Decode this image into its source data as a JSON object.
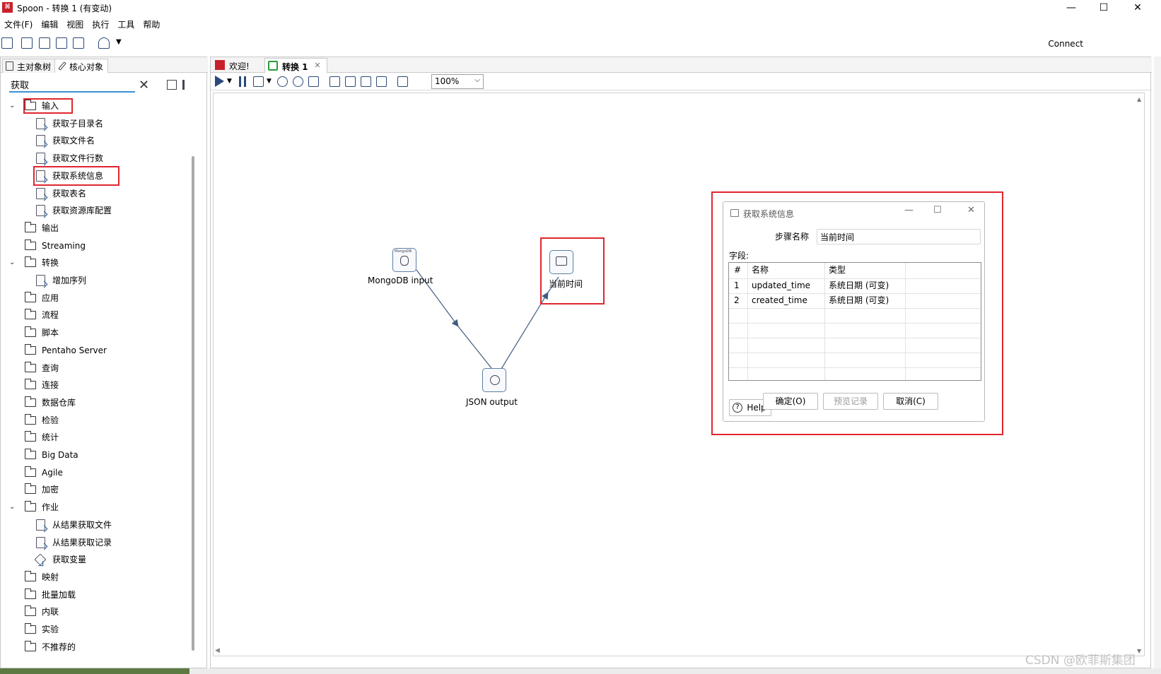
{
  "window": {
    "title": "Spoon - 转换 1 (有变动)",
    "app_icon": "spoon-logo",
    "min_glyph": "—",
    "max_glyph": "☐",
    "close_glyph": "✕"
  },
  "menubar": [
    "文件(F)",
    "编辑",
    "视图",
    "执行",
    "工具",
    "帮助"
  ],
  "toolbar": {
    "connect_label": "Connect"
  },
  "left_panel": {
    "tabs": [
      "主对象树",
      "核心对象"
    ],
    "search": {
      "value": "获取",
      "clear_glyph": "✕"
    },
    "tree": [
      {
        "label": "输入",
        "type": "folder",
        "expanded": true,
        "highlighted": true
      },
      {
        "label": "获取子目录名",
        "type": "step"
      },
      {
        "label": "获取文件名",
        "type": "step"
      },
      {
        "label": "获取文件行数",
        "type": "step"
      },
      {
        "label": "获取系统信息",
        "type": "step",
        "highlighted": true
      },
      {
        "label": "获取表名",
        "type": "step"
      },
      {
        "label": "获取资源库配置",
        "type": "step"
      },
      {
        "label": "输出",
        "type": "folder"
      },
      {
        "label": "Streaming",
        "type": "folder"
      },
      {
        "label": "转换",
        "type": "folder",
        "expanded": true
      },
      {
        "label": "增加序列",
        "type": "step"
      },
      {
        "label": "应用",
        "type": "folder"
      },
      {
        "label": "流程",
        "type": "folder"
      },
      {
        "label": "脚本",
        "type": "folder"
      },
      {
        "label": "Pentaho Server",
        "type": "folder"
      },
      {
        "label": "查询",
        "type": "folder"
      },
      {
        "label": "连接",
        "type": "folder"
      },
      {
        "label": "数据仓库",
        "type": "folder"
      },
      {
        "label": "检验",
        "type": "folder"
      },
      {
        "label": "统计",
        "type": "folder"
      },
      {
        "label": "Big Data",
        "type": "folder"
      },
      {
        "label": "Agile",
        "type": "folder"
      },
      {
        "label": "加密",
        "type": "folder"
      },
      {
        "label": "作业",
        "type": "folder",
        "expanded": true
      },
      {
        "label": "从结果获取文件",
        "type": "step"
      },
      {
        "label": "从结果获取记录",
        "type": "step"
      },
      {
        "label": "获取变量",
        "type": "step"
      },
      {
        "label": "映射",
        "type": "folder"
      },
      {
        "label": "批量加载",
        "type": "folder"
      },
      {
        "label": "内联",
        "type": "folder"
      },
      {
        "label": "实验",
        "type": "folder"
      },
      {
        "label": "不推荐的",
        "type": "folder"
      }
    ]
  },
  "editor": {
    "tabs": [
      {
        "label": "欢迎!",
        "icon": "spoon-logo"
      },
      {
        "label": "转换 1",
        "icon": "transformation-icon",
        "active": true,
        "close_glyph": "✕"
      }
    ],
    "zoom": "100%",
    "canvas": {
      "nodes": [
        {
          "label": "MongoDB input",
          "icon": "mongodb-icon",
          "icon_text": "MongoDB"
        },
        {
          "label": "当前时间",
          "icon": "system-info-icon",
          "highlighted": true
        },
        {
          "label": "JSON output",
          "icon": "json-output-icon"
        }
      ],
      "hops": [
        {
          "from": "MongoDB input",
          "to": "JSON output"
        },
        {
          "from": "JSON output",
          "to": "当前时间"
        }
      ]
    }
  },
  "dialog": {
    "title": "获取系统信息",
    "step_name_label": "步骤名称",
    "step_name_value": "当前时间",
    "fields_label": "字段:",
    "columns": [
      "#",
      "名称",
      "类型"
    ],
    "rows": [
      {
        "num": "1",
        "name": "updated_time",
        "type": "系统日期 (可变)"
      },
      {
        "num": "2",
        "name": "created_time",
        "type": "系统日期 (可变)"
      }
    ],
    "buttons": {
      "help": "Help",
      "ok": "确定(O)",
      "preview": "预览记录",
      "cancel": "取消(C)"
    }
  },
  "watermark": "CSDN @欧菲斯集团",
  "colors": {
    "highlight_red": "#e0262f",
    "brand_red": "#c8202a",
    "hop_blue": "#3f5c80"
  }
}
